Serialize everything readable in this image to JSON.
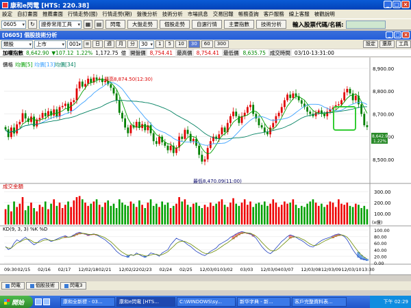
{
  "window": {
    "title": "康和e閃電 [HTS: 220.38]"
  },
  "menu": [
    "設定",
    "自訂畫面",
    "推薦畫面",
    "行情走勢(國)",
    "行情走勢(期)",
    "盤後分析",
    "技術分析",
    "市場訊息",
    "交易回報",
    "帳務查詢",
    "客戶服務",
    "線上客服",
    "被觀說明"
  ],
  "toolbar": {
    "stock_code": "0605",
    "tools_combo": "證券常用工具",
    "buttons": [
      "閃電",
      "大盤走勢",
      "個股走勢",
      "自選行情",
      "主要指數",
      "技術分析"
    ],
    "search_label": "輸入股票代碼/名稱:",
    "search_value": ""
  },
  "child_window": {
    "title": "[0605] 個股技術分析"
  },
  "controls": {
    "type": "類股",
    "market": "上市",
    "code": "001",
    "periods": [
      "日",
      "週",
      "月",
      "分"
    ],
    "minutes": "30",
    "multipliers": [
      "1",
      "5",
      "10",
      "30",
      "60",
      "300"
    ],
    "right_buttons": [
      "設定",
      "還原",
      "工具"
    ]
  },
  "info": {
    "name": "加權指數",
    "price": "8,642.90",
    "change": "▼107.12",
    "pct": "1.22%",
    "volume_label": "1,172.75",
    "unit": "億",
    "open_label": "開盤價",
    "open": "8,754.41",
    "high_label": "最高價",
    "high": "8,754.41",
    "low_label": "最低價",
    "low": "8,635.75",
    "time_label": "成交時間",
    "time": "03/10-13:31:00"
  },
  "legend": {
    "price": "價格",
    "ma1": "均價[5]",
    "ma2": "均價[13]",
    "ma3": "均價[34]"
  },
  "chart_data": {
    "type": "candlestick",
    "price_axis": {
      "min": 8400,
      "max": 8900,
      "ticks": [
        8900,
        8800,
        8700,
        8600,
        8500
      ]
    },
    "tick_labels_price": [
      "8,900.00",
      "8,800.00",
      "8,700.00",
      "8,600.00",
      "8,500.00"
    ],
    "annotations": {
      "high": "最高8,874.50(12:30)",
      "low": "最低8,470.09(11:00)"
    },
    "last_price_tag": "8,642.90",
    "last_pct_tag": "1.22%",
    "volume_title": "成交金額",
    "volume_axis": {
      "max": 300,
      "ticks": [
        "300.00",
        "200.00",
        "100.00"
      ],
      "unit": "(x億)"
    },
    "kd_title": "KD(9, 3, 3)  %K  %D",
    "kd_axis": {
      "ticks": [
        "100.00",
        "80.00",
        "60.00",
        "40.00",
        "20.00",
        "0.00"
      ]
    },
    "x_labels": [
      "09:30",
      "02/15",
      "02/16",
      "02/17",
      "12/02/18",
      "02/21",
      "12/02/22",
      "02/23",
      "02/24",
      "02/25",
      "12/03/01",
      "03/02",
      "03/03",
      "12/03/04",
      "03/07",
      "12/03/08",
      "12/03/09",
      "12/03/10",
      "13:30"
    ],
    "colors": {
      "up": "#e00000",
      "down": "#008000",
      "ma1": "#00a000",
      "ma2": "#3aa0ff",
      "ma3": "#008060",
      "volume_up": "#ee0000",
      "volume_down": "#00a000",
      "k": "#2040c0",
      "d": "#b0b000"
    },
    "closes": [
      8632,
      8598,
      8640,
      8614,
      8654,
      8665,
      8703,
      8680,
      8665,
      8688,
      8645,
      8675,
      8682,
      8704,
      8690,
      8712,
      8693,
      8720,
      8688,
      8730,
      8735,
      8745,
      8713,
      8752,
      8760,
      8812,
      8842,
      8820,
      8832,
      8855,
      8838,
      8860,
      8850,
      8856,
      8840,
      8845,
      8830,
      8815,
      8790,
      8760,
      8705,
      8680,
      8640,
      8615,
      8650,
      8640,
      8665,
      8638,
      8655,
      8628,
      8650,
      8615,
      8580,
      8568,
      8600,
      8575,
      8560,
      8540,
      8560,
      8528,
      8552,
      8600,
      8590,
      8630,
      8612,
      8580,
      8590,
      8560,
      8520,
      8490,
      8500,
      8550,
      8580,
      8600,
      8590,
      8610,
      8640,
      8620,
      8660,
      8690,
      8710,
      8690,
      8660,
      8690,
      8705,
      8730,
      8740,
      8700,
      8680,
      8650,
      8640,
      8620,
      8610,
      8640,
      8660,
      8690,
      8705,
      8730,
      8760,
      8785,
      8770,
      8790,
      8778,
      8760,
      8745,
      8730,
      8710,
      8700,
      8690,
      8705,
      8715,
      8700,
      8690,
      8710,
      8720,
      8728,
      8738,
      8742,
      8760,
      8795,
      8810,
      8790,
      8760,
      8780,
      8742,
      8700,
      8650,
      8642
    ],
    "volumes": [
      140,
      180,
      120,
      210,
      160,
      190,
      250,
      130,
      170,
      200,
      150,
      120,
      180,
      160,
      210,
      140,
      190,
      230,
      170,
      200,
      150,
      180,
      210,
      160,
      220,
      250,
      260,
      230,
      200,
      170,
      190,
      210,
      230,
      180,
      160,
      200,
      220,
      170,
      190,
      150,
      230,
      200,
      180,
      170,
      210,
      190,
      160,
      220,
      180,
      150,
      200,
      230,
      170,
      190,
      160,
      210,
      180,
      200,
      150,
      170,
      190,
      250,
      210,
      230,
      180,
      160,
      190,
      200,
      170,
      150,
      180,
      160,
      200,
      170,
      190,
      210,
      230,
      180,
      160,
      200,
      240,
      190,
      170,
      200,
      230,
      180,
      210,
      160,
      190,
      200,
      180,
      210,
      170,
      190,
      230,
      200,
      160,
      180,
      210,
      190,
      200,
      230,
      180,
      150,
      170,
      160,
      190,
      210,
      230,
      200,
      170,
      190,
      160,
      180,
      210,
      200,
      160,
      230,
      190,
      180,
      200,
      170,
      160,
      190,
      180,
      150,
      170,
      140
    ],
    "k": [
      50,
      40,
      45,
      60,
      70,
      65,
      72,
      78,
      70,
      62,
      55,
      60,
      68,
      72,
      75,
      70,
      65,
      68,
      72,
      76,
      80,
      82,
      78,
      80,
      85,
      90,
      93,
      90,
      88,
      84,
      86,
      88,
      85,
      80,
      75,
      70,
      62,
      55,
      45,
      35,
      28,
      22,
      20,
      18,
      25,
      22,
      30,
      25,
      20,
      18,
      22,
      30,
      28,
      25,
      20,
      30,
      35,
      40,
      55,
      65,
      75,
      70,
      68,
      62,
      55,
      50,
      42,
      35,
      30,
      25,
      22,
      28,
      35,
      40,
      45,
      55,
      60,
      65,
      70,
      78,
      82,
      88,
      92,
      95,
      93,
      90,
      88,
      82,
      75,
      62,
      50,
      40,
      32,
      28,
      35,
      45,
      55,
      65,
      72,
      80,
      85,
      82,
      78,
      72,
      68,
      62,
      55,
      50,
      48,
      55,
      62,
      68,
      72,
      75,
      78,
      82,
      86,
      88,
      85,
      80,
      70,
      55,
      40,
      28,
      18,
      12,
      10,
      8
    ],
    "d": [
      48,
      45,
      45,
      52,
      60,
      63,
      68,
      72,
      72,
      68,
      62,
      61,
      63,
      67,
      70,
      70,
      68,
      68,
      70,
      72,
      76,
      78,
      78,
      79,
      82,
      86,
      89,
      90,
      89,
      87,
      86,
      87,
      86,
      83,
      80,
      76,
      70,
      64,
      56,
      47,
      39,
      32,
      27,
      23,
      24,
      23,
      26,
      26,
      24,
      21,
      21,
      24,
      26,
      26,
      23,
      25,
      29,
      34,
      42,
      50,
      59,
      64,
      66,
      65,
      61,
      57,
      51,
      45,
      39,
      33,
      29,
      28,
      30,
      34,
      38,
      44,
      50,
      56,
      61,
      68,
      74,
      80,
      86,
      90,
      92,
      91,
      90,
      86,
      81,
      73,
      63,
      54,
      45,
      38,
      36,
      38,
      44,
      52,
      60,
      68,
      76,
      79,
      79,
      77,
      73,
      69,
      63,
      57,
      53,
      53,
      56,
      61,
      66,
      70,
      74,
      77,
      81,
      84,
      85,
      83,
      78,
      68,
      56,
      44,
      33,
      24,
      17,
      12
    ]
  },
  "bottom_tabs": [
    "閃電",
    "個股技術",
    "閃電3"
  ],
  "taskbar": {
    "start_label": "開始",
    "tasks": [
      "康和全新標 - 03...",
      "康和e閃電 [HTS...",
      "C:\\WINDOWS\\sy...",
      "新华字典 - 新...",
      "客戶完整資料表..."
    ],
    "clock": "下午 02:29"
  }
}
